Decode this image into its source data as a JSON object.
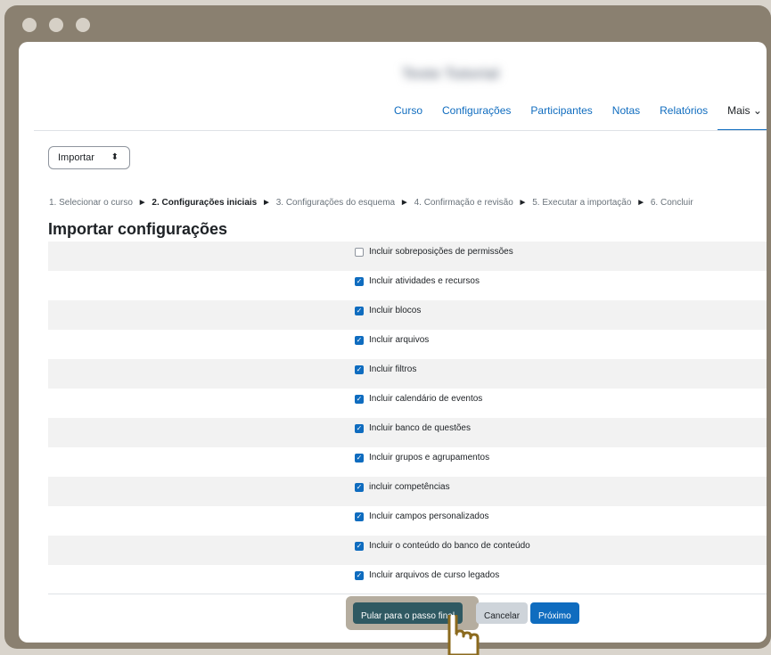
{
  "course": {
    "title": "Teste Tutorial"
  },
  "nav": {
    "items": [
      {
        "label": "Curso"
      },
      {
        "label": "Configurações"
      },
      {
        "label": "Participantes"
      },
      {
        "label": "Notas"
      },
      {
        "label": "Relatórios"
      },
      {
        "label": "Mais ⌄"
      }
    ]
  },
  "select": {
    "value": "Importar",
    "caret": "⬍"
  },
  "steps": {
    "s1": "1. Selecionar o curso",
    "s2": "2. Configurações iniciais",
    "s3": "3. Configurações do esquema",
    "s4": "4. Confirmação e revisão",
    "s5": "5. Executar a importação",
    "s6": "6. Concluir",
    "arrow": "►"
  },
  "heading": "Importar configurações",
  "settings": [
    {
      "label": "Incluir sobreposições de permissões",
      "checked": false
    },
    {
      "label": "Incluir atividades e recursos",
      "checked": true
    },
    {
      "label": "Incluir blocos",
      "checked": true
    },
    {
      "label": "Incluir arquivos",
      "checked": true
    },
    {
      "label": "Incluir filtros",
      "checked": true
    },
    {
      "label": "Incluir calendário de eventos",
      "checked": true
    },
    {
      "label": "Incluir banco de questões",
      "checked": true
    },
    {
      "label": "Incluir grupos e agrupamentos",
      "checked": true
    },
    {
      "label": "incluir competências",
      "checked": true
    },
    {
      "label": "Incluir campos personalizados",
      "checked": true
    },
    {
      "label": "Incluir o conteúdo do banco de conteúdo",
      "checked": true
    },
    {
      "label": "Incluir arquivos de curso legados",
      "checked": true
    }
  ],
  "buttons": {
    "skip": "Pular para o passo final",
    "cancel": "Cancelar",
    "next": "Próximo"
  },
  "colors": {
    "accent": "#0f6cbf",
    "skip_button": "#2f5962",
    "frame": "#8a8070"
  }
}
